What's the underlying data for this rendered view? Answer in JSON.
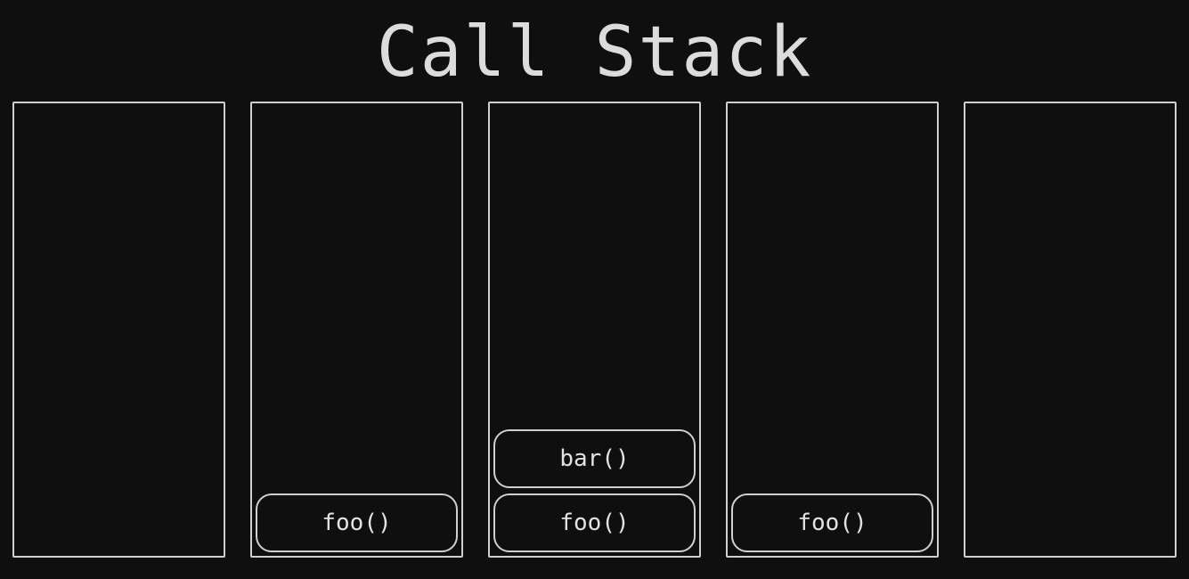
{
  "title": "Call Stack",
  "stacks": [
    {
      "frames": []
    },
    {
      "frames": [
        "foo()"
      ]
    },
    {
      "frames": [
        "bar()",
        "foo()"
      ]
    },
    {
      "frames": [
        "foo()"
      ]
    },
    {
      "frames": []
    }
  ]
}
